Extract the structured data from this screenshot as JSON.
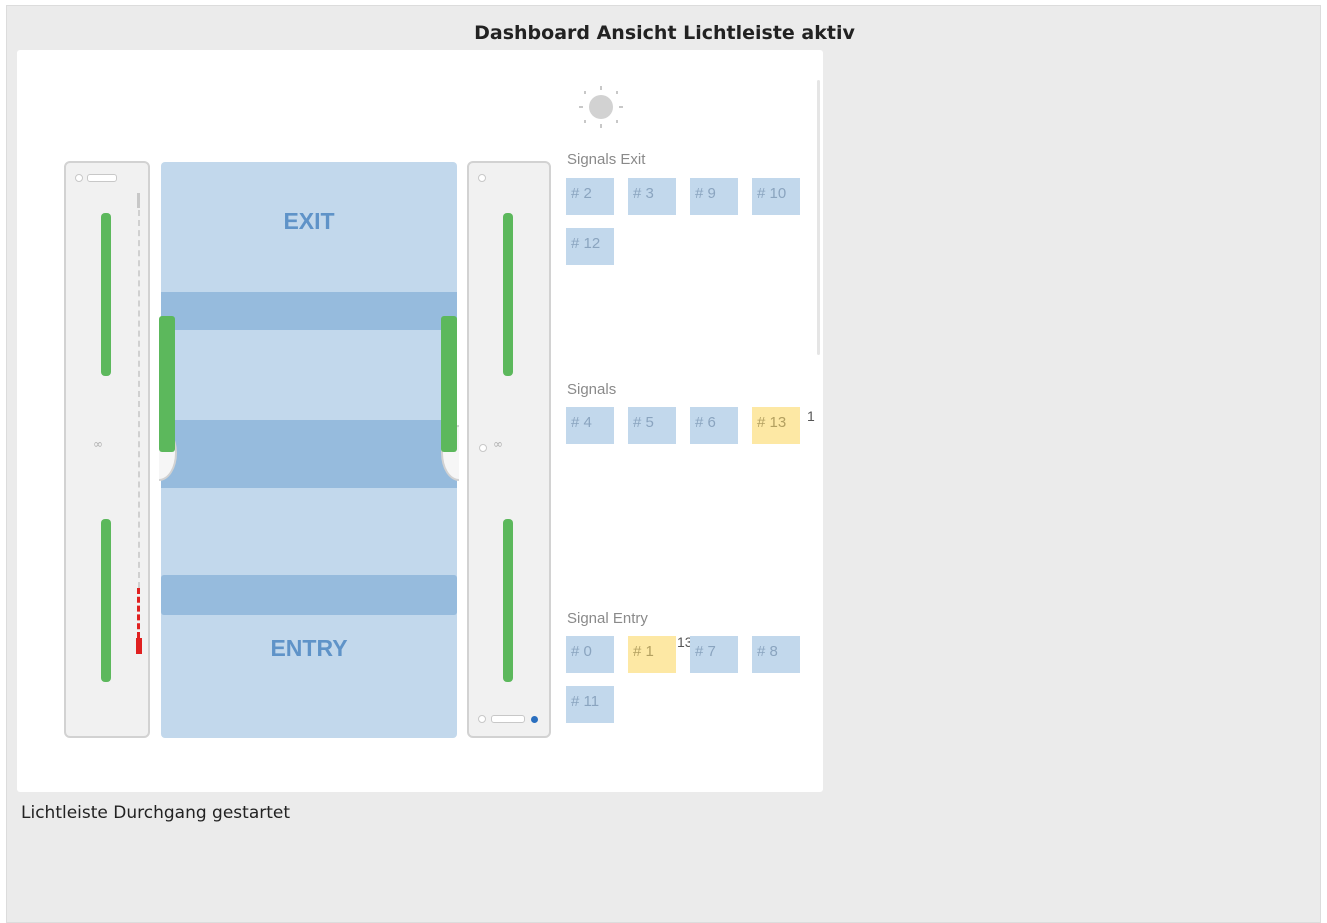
{
  "page": {
    "title": "Dashboard Ansicht Lichtleiste aktiv",
    "caption": "Lichtleiste Durchgang gestartet"
  },
  "lane": {
    "exit_label": "EXIT",
    "entry_label": "ENTRY"
  },
  "signals": {
    "exit": {
      "label": "Signals Exit",
      "chips": [
        "# 2",
        "# 3",
        "# 9",
        "# 10",
        "# 12"
      ]
    },
    "middle": {
      "label": "Signals",
      "chips": [
        "# 4",
        "# 5",
        "# 6",
        "# 13"
      ],
      "note": "1"
    },
    "entry": {
      "label": "Signal Entry",
      "chips": [
        "# 0",
        "# 1",
        "# 7",
        "# 8",
        "# 11"
      ],
      "note": "13"
    }
  },
  "colors": {
    "lane": "#c2d8ec",
    "band": "#96bbdd",
    "sensor_green": "#5cb85c",
    "alarm_red": "#e02020",
    "chip_active": "#fde8a4"
  },
  "icons": [
    "sun-icon",
    "link-icon"
  ]
}
